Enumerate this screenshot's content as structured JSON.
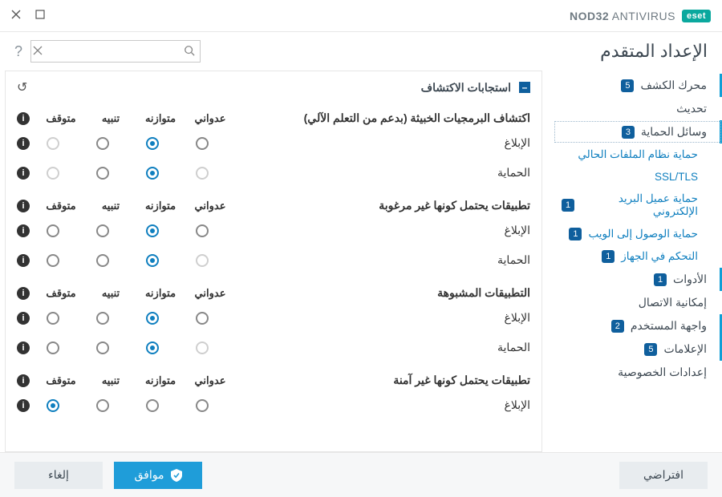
{
  "brand": {
    "pill": "eset",
    "product_bold": "NOD32",
    "product_rest": "ANTIVIRUS"
  },
  "window": {
    "title": "الإعداد المتقدم"
  },
  "search": {
    "placeholder": "",
    "value": ""
  },
  "sidebar": {
    "items": [
      {
        "label": "محرك الكشف",
        "badge": "5",
        "type": "top",
        "marker": true
      },
      {
        "label": "تحديث",
        "type": "top"
      },
      {
        "label": "وسائل الحماية",
        "badge": "3",
        "type": "top",
        "selected": true,
        "marker": true
      },
      {
        "label": "حماية نظام الملفات الحالي",
        "type": "sub"
      },
      {
        "label": "SSL/TLS",
        "type": "sub"
      },
      {
        "label": "حماية عميل البريد الإلكتروني",
        "badge": "1",
        "type": "sub"
      },
      {
        "label": "حماية الوصول إلى الويب",
        "badge": "1",
        "type": "sub"
      },
      {
        "label": "التحكم في الجهاز",
        "badge": "1",
        "type": "sub"
      },
      {
        "label": "الأدوات",
        "badge": "1",
        "type": "top",
        "marker": true
      },
      {
        "label": "إمكانية الاتصال",
        "type": "top"
      },
      {
        "label": "واجهة المستخدم",
        "badge": "2",
        "type": "top",
        "marker": true
      },
      {
        "label": "الإعلامات",
        "badge": "5",
        "type": "top",
        "marker": true
      },
      {
        "label": "إعدادات الخصوصية",
        "type": "top"
      }
    ]
  },
  "panel": {
    "title": "استجابات الاكتشاف",
    "columns": [
      "عدواني",
      "متوازنه",
      "تنبيه",
      "متوقف"
    ],
    "groups": [
      {
        "name": "اكتشاف البرمجيات الخبيثة (بدعم من التعلم الآلي)",
        "rows": [
          {
            "label": "الإبلاغ",
            "selected": 1,
            "disabled": [
              3
            ]
          },
          {
            "label": "الحماية",
            "selected": 1,
            "disabled": [
              0,
              3
            ]
          }
        ]
      },
      {
        "name": "تطبيقات يحتمل كونها غير مرغوبة",
        "rows": [
          {
            "label": "الإبلاغ",
            "selected": 1,
            "disabled": []
          },
          {
            "label": "الحماية",
            "selected": 1,
            "disabled": [
              0
            ]
          }
        ]
      },
      {
        "name": "التطبيقات المشبوهة",
        "rows": [
          {
            "label": "الإبلاغ",
            "selected": 1,
            "disabled": []
          },
          {
            "label": "الحماية",
            "selected": 1,
            "disabled": [
              0
            ]
          }
        ]
      },
      {
        "name": "تطبيقات يحتمل كونها غير آمنة",
        "rows": [
          {
            "label": "الإبلاغ",
            "selected": 3,
            "disabled": []
          }
        ]
      }
    ]
  },
  "footer": {
    "default": "افتراضي",
    "ok": "موافق",
    "cancel": "إلغاء"
  }
}
